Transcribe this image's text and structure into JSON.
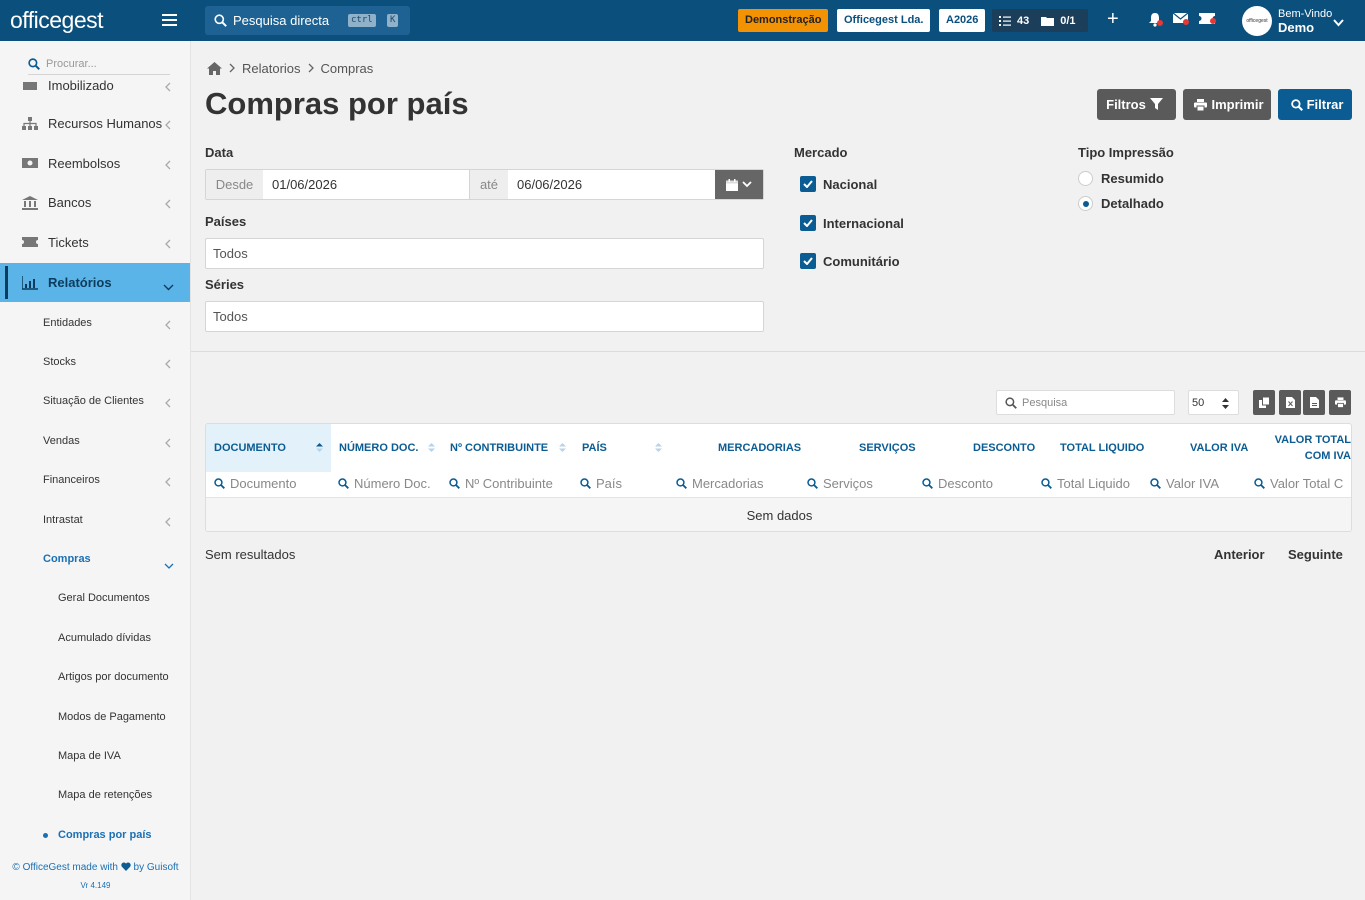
{
  "topbar": {
    "logo": "officegest",
    "search_label": "Pesquisa directa",
    "kbd_ctrl": "ctrl",
    "kbd_k": "K",
    "badge_demo": "Demonstração",
    "badge_company": "Officegest Lda.",
    "badge_year": "A2026",
    "tasks_count": "43",
    "folder_count": "0/1",
    "user_greeting": "Bem-Vindo",
    "user_name": "Demo",
    "avatar_text": "officegest"
  },
  "sidebar": {
    "search_placeholder": "Procurar...",
    "items": [
      {
        "label": "Imobilizado",
        "icon": "building-icon"
      },
      {
        "label": "Recursos Humanos",
        "icon": "org-chart-icon"
      },
      {
        "label": "Reembolsos",
        "icon": "money-icon"
      },
      {
        "label": "Bancos",
        "icon": "bank-icon"
      },
      {
        "label": "Tickets",
        "icon": "ticket-icon"
      },
      {
        "label": "Relatórios",
        "icon": "chart-icon"
      }
    ],
    "reports_sub": [
      "Entidades",
      "Stocks",
      "Situação de Clientes",
      "Vendas",
      "Financeiros",
      "Intrastat",
      "Compras"
    ],
    "purchases_sub": [
      "Geral Documentos",
      "Acumulado dívidas",
      "Artigos por documento",
      "Modos de Pagamento",
      "Mapa de IVA",
      "Mapa de retenções",
      "Compras por país"
    ],
    "footer_left": "© OfficeGest made with",
    "footer_right": "by Guisoft",
    "version": "Vr 4.149"
  },
  "breadcrumb": [
    "Relatorios",
    "Compras"
  ],
  "page_title": "Compras por país",
  "buttons": {
    "filtros": "Filtros",
    "imprimir": "Imprimir",
    "filtrar": "Filtrar"
  },
  "form": {
    "date_label": "Data",
    "from_label": "Desde",
    "from_value": "01/06/2026",
    "to_label": "até",
    "to_value": "06/06/2026",
    "countries_label": "Países",
    "countries_value": "Todos",
    "series_label": "Séries",
    "series_value": "Todos",
    "market_label": "Mercado",
    "market_options": [
      {
        "label": "Nacional",
        "checked": true
      },
      {
        "label": "Internacional",
        "checked": true
      },
      {
        "label": "Comunitário",
        "checked": true
      }
    ],
    "print_type_label": "Tipo Impressão",
    "print_options": [
      {
        "label": "Resumido",
        "selected": false
      },
      {
        "label": "Detalhado",
        "selected": true
      }
    ]
  },
  "table": {
    "search_placeholder": "Pesquisa",
    "page_size": "50",
    "columns": [
      "DOCUMENTO",
      "NÚMERO DOC.",
      "Nº CONTRIBUINTE",
      "PAÍS",
      "MERCADORIAS",
      "SERVIÇOS",
      "DESCONTO",
      "TOTAL LIQUIDO",
      "VALOR IVA",
      "VALOR TOTAL",
      "COM IVA"
    ],
    "filters": [
      "Documento",
      "Número Doc.",
      "Nº Contribuinte",
      "País",
      "Mercadorias",
      "Serviços",
      "Desconto",
      "Total Liquido",
      "Valor IVA",
      "Valor Total C"
    ],
    "empty": "Sem dados"
  },
  "footer": {
    "no_results": "Sem resultados",
    "prev": "Anterior",
    "next": "Seguinte"
  }
}
